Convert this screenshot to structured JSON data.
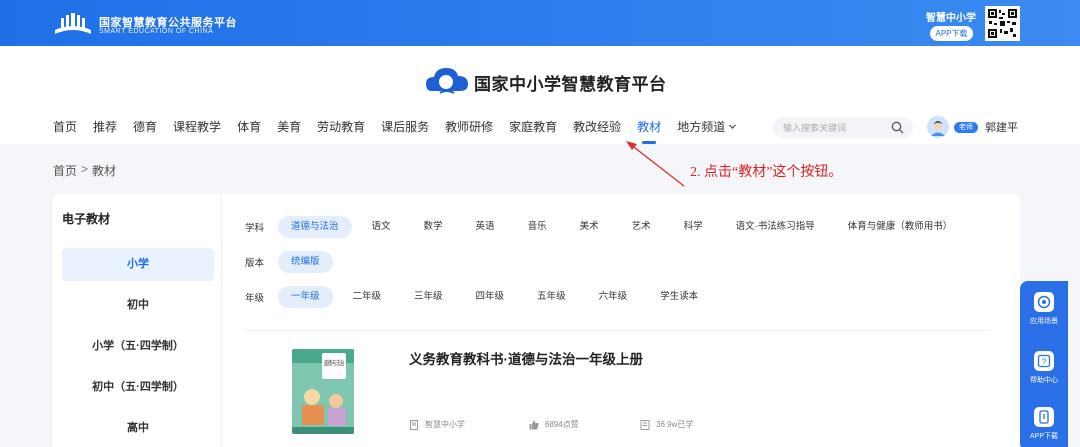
{
  "topbar": {
    "logo_cn": "国家智慧教育公共服务平台",
    "logo_en": "SMART EDUCATION OF CHINA",
    "app_name": "智慧中小学",
    "app_download": "APP下载"
  },
  "header": {
    "brand": "国家中小学智慧教育平台",
    "nav": [
      "首页",
      "推荐",
      "德育",
      "课程教学",
      "体育",
      "美育",
      "劳动教育",
      "课后服务",
      "教师研修",
      "家庭教育",
      "教改经验",
      "教材",
      "地方频道"
    ],
    "nav_active_index": 11,
    "search_placeholder": "输入搜索关键词",
    "user": {
      "role": "老师",
      "name": "郭建平"
    }
  },
  "breadcrumb": {
    "home": "首页",
    "separator": ">",
    "current": "教材"
  },
  "annotation": {
    "text": "2. 点击“教材”这个按钮。",
    "color": "#e02020"
  },
  "sidebar": {
    "title": "电子教材",
    "items": [
      "小学",
      "初中",
      "小学（五·四学制）",
      "初中（五·四学制）",
      "高中"
    ],
    "active_index": 0
  },
  "filters": {
    "subject": {
      "label": "学科",
      "options": [
        "道德与法治",
        "语文",
        "数学",
        "英语",
        "音乐",
        "美术",
        "艺术",
        "科学",
        "语文·书法练习指导",
        "体育与健康（教师用书）"
      ],
      "active_index": 0
    },
    "edition": {
      "label": "版本",
      "options": [
        "统编版"
      ],
      "active_index": 0
    },
    "grade": {
      "label": "年级",
      "options": [
        "一年级",
        "二年级",
        "三年级",
        "四年级",
        "五年级",
        "六年级",
        "学生读本"
      ],
      "active_index": 0
    }
  },
  "book": {
    "title": "义务教育教科书·道德与法治一年级上册",
    "cover_text": "道德与法治",
    "publisher": "智慧中小学",
    "likes": "6894点赞",
    "views": "36.9w已学"
  },
  "float_panel": {
    "items": [
      "应用场景",
      "帮助中心",
      "APP下载"
    ]
  },
  "colors": {
    "primary": "#1f6fe8",
    "accent_red": "#e02020"
  }
}
